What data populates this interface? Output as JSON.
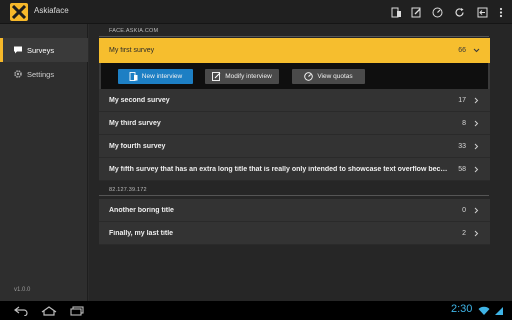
{
  "app": {
    "title": "Askiaface",
    "logo_icon": "askia-logo-icon"
  },
  "actionbar": {
    "icons": [
      "mobile-device-icon",
      "edit-document-icon",
      "gauge-icon",
      "refresh-icon",
      "sign-out-icon",
      "overflow-menu-icon"
    ]
  },
  "sidebar": {
    "items": [
      {
        "label": "Surveys",
        "icon": "chat-bubble-icon",
        "active": true
      },
      {
        "label": "Settings",
        "icon": "gear-icon",
        "active": false
      }
    ],
    "version": "v1.0.0"
  },
  "groups": [
    {
      "header": "FACE.ASKIA.COM",
      "surveys": [
        {
          "title": "My first survey",
          "count": "66",
          "expanded": true
        },
        {
          "title": "My second survey",
          "count": "17"
        },
        {
          "title": "My third survey",
          "count": "8"
        },
        {
          "title": "My fourth survey",
          "count": "33"
        },
        {
          "title": "My fifth survey that has an extra long title that is really only intended to showcase text overflow becau...",
          "count": "58"
        }
      ]
    },
    {
      "header": "82.127.39.172",
      "surveys": [
        {
          "title": "Another boring title",
          "count": "0"
        },
        {
          "title": "Finally, my last title",
          "count": "2"
        }
      ]
    }
  ],
  "actions": {
    "new_interview": "New interview",
    "modify_interview": "Modify interview",
    "view_quotas": "View quotas"
  },
  "systembar": {
    "time": "2:30"
  },
  "colors": {
    "accent": "#f6be2e",
    "primary_button": "#1d7fc4",
    "clock": "#3fb4e6"
  }
}
